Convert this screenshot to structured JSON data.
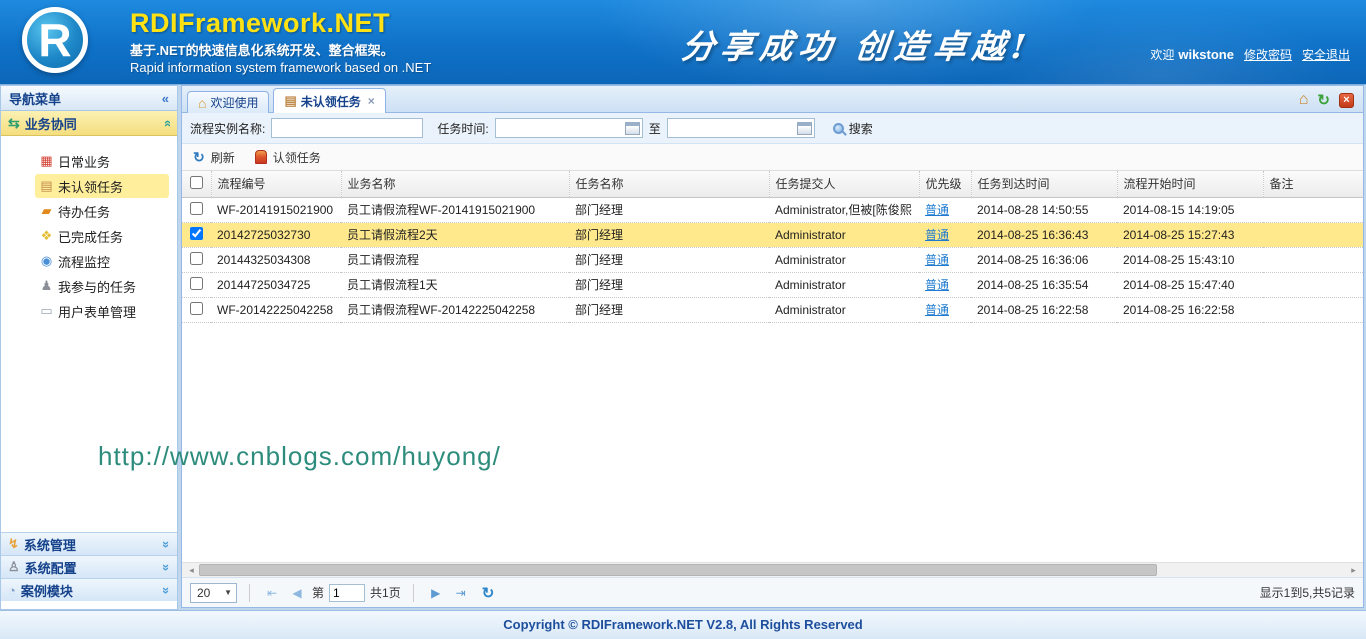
{
  "header": {
    "logo_letter": "R",
    "title": "RDIFramework.NET",
    "subtitle_cn": "基于.NET的快速信息化系统开发、整合框架。",
    "subtitle_en": "Rapid information system framework based on .NET",
    "slogan": "分享成功  创造卓越!",
    "welcome_prefix": "欢迎",
    "username": "wikstone",
    "change_password": "修改密码",
    "logout": "安全退出"
  },
  "sidebar": {
    "title": "导航菜单",
    "sections": [
      {
        "label": "业务协同"
      },
      {
        "label": "系统管理"
      },
      {
        "label": "系统配置"
      },
      {
        "label": "案例模块"
      }
    ],
    "items": [
      {
        "label": "日常业务",
        "icon_glyph": "▦"
      },
      {
        "label": "未认领任务",
        "icon_glyph": "▤",
        "selected": true
      },
      {
        "label": "待办任务",
        "icon_glyph": "▰"
      },
      {
        "label": "已完成任务",
        "icon_glyph": "❖"
      },
      {
        "label": "流程监控",
        "icon_glyph": "◉"
      },
      {
        "label": "我参与的任务",
        "icon_glyph": "♟"
      },
      {
        "label": "用户表单管理",
        "icon_glyph": "▭"
      }
    ],
    "section_icons": {
      "collaboration": "⇆",
      "sysmgmt": "↯",
      "sysconfig": "♙",
      "casemodule": "◔"
    }
  },
  "tabs": [
    {
      "label": "欢迎使用"
    },
    {
      "label": "未认领任务",
      "active": true
    }
  ],
  "icons": {
    "nav_collapse": "«",
    "chevron_double": "»",
    "tab_home": "⌂",
    "tab_doc": "▤",
    "tab_close": "×",
    "tool_home": "⌂",
    "tool_refresh": "↻",
    "tool_close": "×",
    "refresh": "↻",
    "pager_first": "⇤",
    "pager_prev": "◀",
    "pager_next": "▶",
    "pager_last": "⇥",
    "pager_refresh": "↻",
    "select_caret": "▼",
    "scroll_left": "◂",
    "scroll_right": "▸"
  },
  "filter": {
    "instance_label": "流程实例名称:",
    "instance_value": "",
    "time_label": "任务时间:",
    "time_from_value": "",
    "to_label": "至",
    "time_to_value": "",
    "search_label": "搜索"
  },
  "toolbar": {
    "refresh_label": "刷新",
    "claim_label": "认领任务"
  },
  "grid": {
    "columns": [
      "流程编号",
      "业务名称",
      "任务名称",
      "任务提交人",
      "优先级",
      "任务到达时间",
      "流程开始时间",
      "备注"
    ],
    "rows": [
      {
        "id": "WF-20141915021900",
        "business": "员工请假流程WF-20141915021900",
        "task": "部门经理",
        "submitter": "Administrator,但被[陈俊熙",
        "priority": "普通",
        "arrive": "2014-08-28 14:50:55",
        "start": "2014-08-15 14:19:05",
        "remark": "",
        "checked": false
      },
      {
        "id": "20142725032730",
        "business": "员工请假流程2天",
        "task": "部门经理",
        "submitter": "Administrator",
        "priority": "普通",
        "arrive": "2014-08-25 16:36:43",
        "start": "2014-08-25 15:27:43",
        "remark": "",
        "checked": true
      },
      {
        "id": "20144325034308",
        "business": "员工请假流程",
        "task": "部门经理",
        "submitter": "Administrator",
        "priority": "普通",
        "arrive": "2014-08-25 16:36:06",
        "start": "2014-08-25 15:43:10",
        "remark": "",
        "checked": false
      },
      {
        "id": "20144725034725",
        "business": "员工请假流程1天",
        "task": "部门经理",
        "submitter": "Administrator",
        "priority": "普通",
        "arrive": "2014-08-25 16:35:54",
        "start": "2014-08-25 15:47:40",
        "remark": "",
        "checked": false
      },
      {
        "id": "WF-20142225042258",
        "business": "员工请假流程WF-20142225042258",
        "task": "部门经理",
        "submitter": "Administrator",
        "priority": "普通",
        "arrive": "2014-08-25 16:22:58",
        "start": "2014-08-25 16:22:58",
        "remark": "",
        "checked": false
      }
    ]
  },
  "pagination": {
    "page_size": "20",
    "page_label_prefix": "第",
    "page_value": "1",
    "page_label_suffix": "共1页",
    "summary": "显示1到5,共5记录"
  },
  "watermark": "http://www.cnblogs.com/huyong/",
  "footer": {
    "copyright": "Copyright © RDIFramework.NET V2.8, All Rights Reserved"
  },
  "colors": {
    "brand_yellow": "#FFE213",
    "header_blue": "#0F72C8",
    "priority_link": "#1E7BD0",
    "selected_row": "#FFE98C",
    "sidebar_highlight": "#FFEF9C",
    "watermark_teal": "#2D8C7C"
  }
}
